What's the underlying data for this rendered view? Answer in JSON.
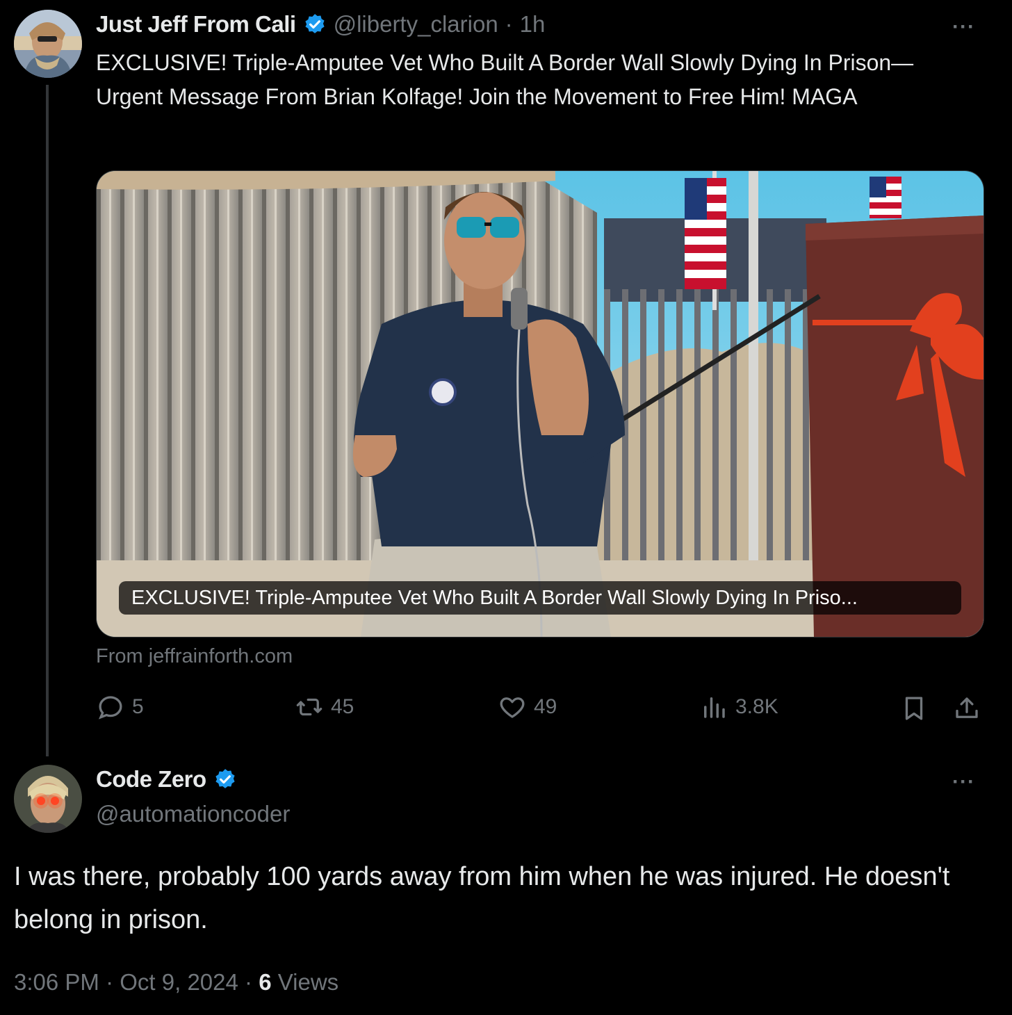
{
  "post": {
    "author_name": "Just Jeff From Cali",
    "handle": "@liberty_clarion",
    "separator": "·",
    "time": "1h",
    "more_label": "···",
    "text": "EXCLUSIVE! Triple-Amputee Vet Who Built A Border Wall Slowly Dying In Prison—Urgent Message From Brian Kolfage! Join the Movement to Free Him! MAGA",
    "card": {
      "caption": "EXCLUSIVE! Triple-Amputee Vet Who Built A Border Wall Slowly Dying In Priso...",
      "source": "From jeffrainforth.com"
    },
    "actions": {
      "replies": "5",
      "reposts": "45",
      "likes": "49",
      "views": "3.8K"
    }
  },
  "reply": {
    "author_name": "Code Zero",
    "handle": "@automationcoder",
    "more_label": "···",
    "text": "I was there, probably 100 yards away from him when he was injured.  He doesn't belong in prison.",
    "time": "3:06 PM",
    "date": "Oct 9, 2024",
    "views_count": "6",
    "views_label": "Views",
    "separator": "·"
  },
  "colors": {
    "background": "#000000",
    "verified": "#1d9bf0",
    "muted": "#71767b",
    "text": "#e7e9ea"
  }
}
